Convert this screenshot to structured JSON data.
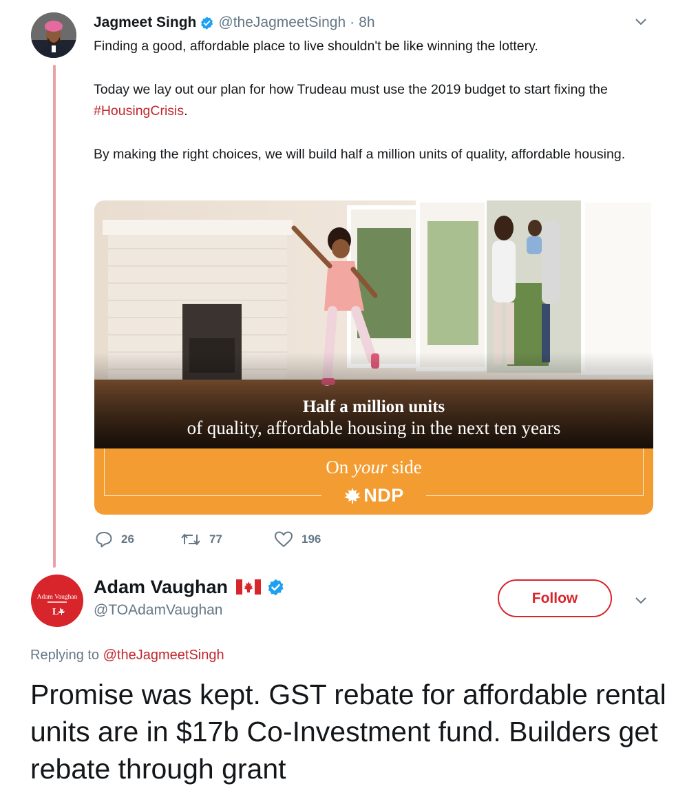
{
  "tweet1": {
    "name": "Jagmeet Singh",
    "handle": "@theJagmeetSingh",
    "separator": "·",
    "time": "8h",
    "para1": "Finding a good, affordable place to live shouldn't be like winning the lottery.",
    "para2_prefix": "Today we lay out our plan for how Trudeau must use the 2019 budget to start fixing the ",
    "para2_hashtag": "#HousingCrisis",
    "para2_suffix": ".",
    "para3": "By making the right choices, we will build half a million units of quality, affordable housing.",
    "card": {
      "headline": "Half a million units",
      "subline": "of quality, affordable housing in the next ten years",
      "tag_pre": "On ",
      "tag_em": "your",
      "tag_post": " side",
      "logo_text": "NDP"
    },
    "actions": {
      "replies": "26",
      "retweets": "77",
      "likes": "196"
    }
  },
  "tweet2": {
    "name": "Adam Vaughan",
    "handle": "@TOAdamVaughan",
    "avatar_text": "Adam Vaughan",
    "follow_label": "Follow",
    "replying_prefix": "Replying to ",
    "replying_mention": "@theJagmeetSingh",
    "body": "Promise was kept. GST rebate for affordable rental units are in $17b Co-Investment fund. Builders get rebate through grant"
  },
  "colors": {
    "accent_red": "#c0272d",
    "follow_red": "#d8242b",
    "ndp_orange": "#f39c31",
    "muted_text": "#657786",
    "verified_blue": "#1da1f2",
    "thread_line": "#e8a3a6"
  }
}
